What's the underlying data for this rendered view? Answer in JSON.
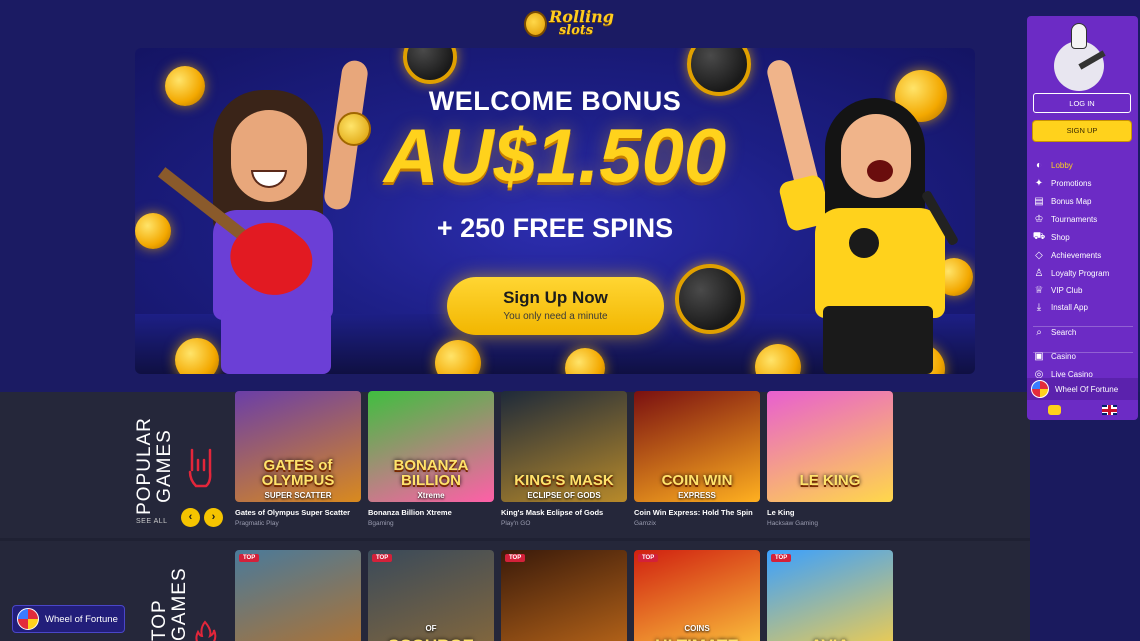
{
  "brand": {
    "line1": "Rolling",
    "line2": "slots"
  },
  "banner": {
    "title": "WELCOME BONUS",
    "amount": "AU$1.500",
    "spins": "+ 250 FREE SPINS",
    "cta_label": "Sign Up Now",
    "cta_sub": "You only need a minute"
  },
  "popular": {
    "title": "POPULAR GAMES",
    "see_all": "SEE ALL",
    "prev_icon": "chevron-left-icon",
    "next_icon": "chevron-right-icon",
    "games": [
      {
        "name": "Gates of Olympus Super Scatter",
        "provider": "Pragmatic Play",
        "art": "GATES of OLYMPUS",
        "art_sub": "SUPER SCATTER",
        "colors": [
          "#6a3ea8",
          "#d98a1e"
        ]
      },
      {
        "name": "Bonanza Billion Xtreme",
        "provider": "Bgaming",
        "art": "BONANZA BILLION",
        "art_sub": "Xtreme",
        "colors": [
          "#3fbf3f",
          "#ff5fa8"
        ]
      },
      {
        "name": "King's Mask Eclipse of Gods",
        "provider": "Play'n GO",
        "art": "KING'S MASK",
        "art_sub": "ECLIPSE OF GODS",
        "colors": [
          "#1e2a3a",
          "#b88a2a"
        ]
      },
      {
        "name": "Coin Win Express: Hold The Spin",
        "provider": "Gamzix",
        "art": "COIN WIN",
        "art_sub": "EXPRESS",
        "colors": [
          "#7a1010",
          "#ffb020"
        ]
      },
      {
        "name": "Le King",
        "provider": "Hacksaw Gaming",
        "art": "LE KING",
        "art_sub": "",
        "colors": [
          "#e85fd0",
          "#ffd84a"
        ]
      }
    ]
  },
  "top": {
    "title": "TOP GAMES",
    "badge": "TOP",
    "games": [
      {
        "art": "",
        "art_sub": "",
        "colors": [
          "#4a7a9a",
          "#b8722a"
        ]
      },
      {
        "art": "SCOURGE",
        "art_sub": "OF",
        "colors": [
          "#3a4a5a",
          "#8a6a3a"
        ]
      },
      {
        "art": "",
        "art_sub": "",
        "colors": [
          "#3a1a0a",
          "#c06a1a"
        ]
      },
      {
        "art": "ULTIMATE",
        "art_sub": "COINS",
        "colors": [
          "#d02010",
          "#ffd040"
        ]
      },
      {
        "art": "AVIA",
        "art_sub": "",
        "colors": [
          "#3aa0ff",
          "#ffd040"
        ]
      }
    ]
  },
  "sidebar": {
    "login_label": "LOG IN",
    "signup_label": "SIGN UP",
    "items": [
      {
        "label": "Lobby",
        "icon": "lobby-icon",
        "glyph": "◐",
        "active": true
      },
      {
        "label": "Promotions",
        "icon": "promotions-icon",
        "glyph": "✦",
        "active": false
      },
      {
        "label": "Bonus Map",
        "icon": "map-icon",
        "glyph": "▤",
        "active": false
      },
      {
        "label": "Tournaments",
        "icon": "trophy-icon",
        "glyph": "♔",
        "active": false
      },
      {
        "label": "Shop",
        "icon": "cart-icon",
        "glyph": "⛟",
        "active": false
      },
      {
        "label": "Achievements",
        "icon": "diamond-icon",
        "glyph": "◇",
        "active": false
      },
      {
        "label": "Loyalty Program",
        "icon": "loyalty-icon",
        "glyph": "♙",
        "active": false
      },
      {
        "label": "VIP Club",
        "icon": "crown-icon",
        "glyph": "♕",
        "active": false
      },
      {
        "label": "Install App",
        "icon": "install-icon",
        "glyph": "⤓",
        "active": false
      },
      {
        "label": "Search",
        "icon": "search-icon",
        "glyph": "⌕",
        "active": false
      },
      {
        "label": "Casino",
        "icon": "casino-icon",
        "glyph": "▣",
        "active": false
      },
      {
        "label": "Live Casino",
        "icon": "live-casino-icon",
        "glyph": "◎",
        "active": false
      }
    ],
    "wheel_label": "Wheel Of Fortune",
    "chat_icon": "chat-icon",
    "language_icon": "uk-flag-icon"
  },
  "floating_wheel": {
    "label": "Wheel of Fortune"
  },
  "colors": {
    "accent": "#ffd21c",
    "sidebar": "#6c2bc5",
    "page": "#1b1b63",
    "section": "#25273a"
  }
}
